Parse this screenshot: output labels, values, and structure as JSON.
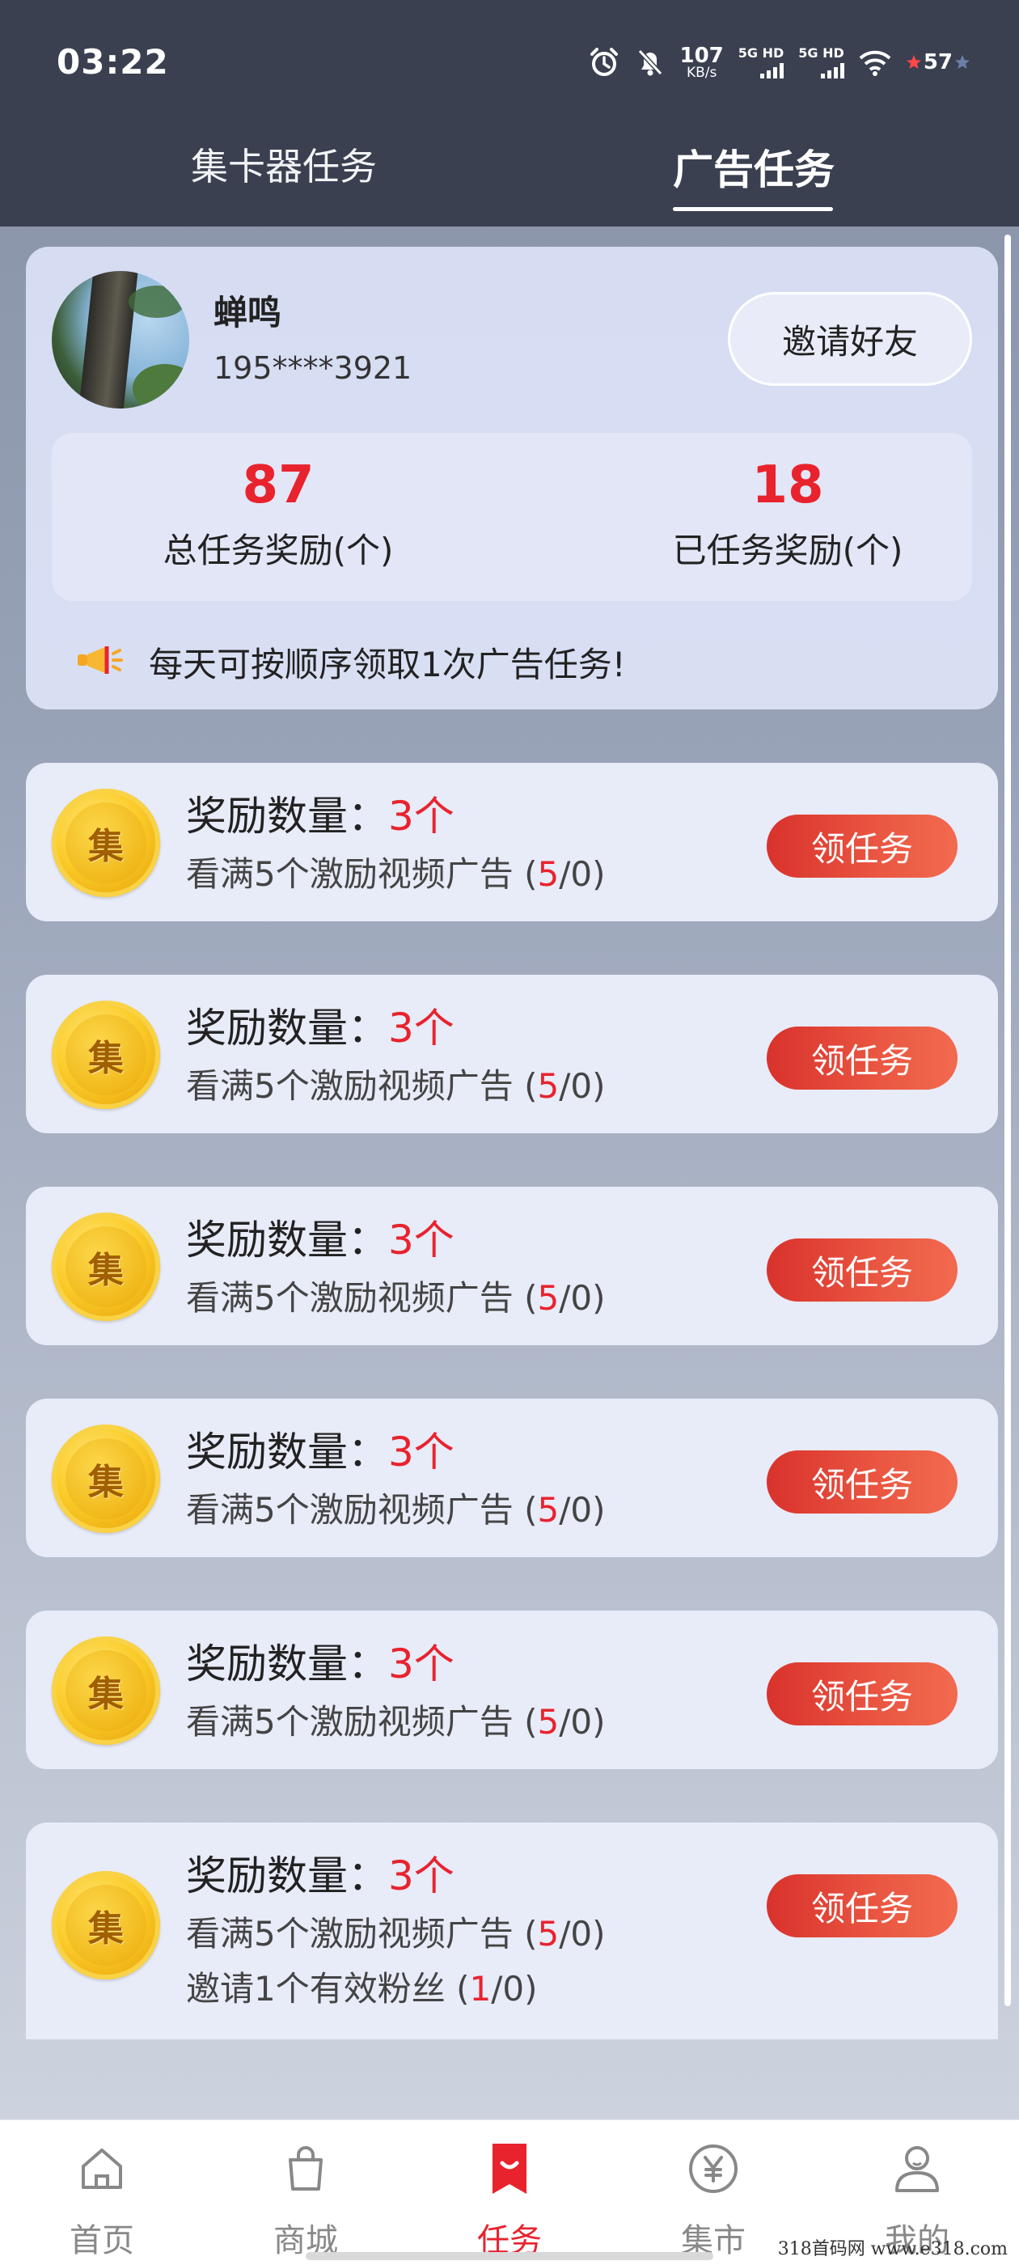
{
  "status_bar": {
    "time": "03:22",
    "net_speed_value": "107",
    "net_speed_unit": "KB/s",
    "signal_1_label": "5G HD",
    "signal_2_label": "5G HD",
    "battery": "57"
  },
  "tabs": [
    {
      "label": "集卡器任务"
    },
    {
      "label": "广告任务"
    }
  ],
  "profile": {
    "nickname": "蝉鸣",
    "phone": "195****3921",
    "invite_label": "邀请好友"
  },
  "stats": {
    "total_value": "87",
    "total_label": "总任务奖励(个)",
    "done_value": "18",
    "done_label": "已任务奖励(个)"
  },
  "notice": "每天可按顺序领取1次广告任务!",
  "tasks": [
    {
      "title_prefix": "奖励数量：",
      "reward": "3个",
      "desc_prefix": "看满5个激励视频广告 (",
      "progress_num": "5",
      "progress_suffix": "/0)",
      "button": "领任务",
      "coin_char": "集"
    },
    {
      "title_prefix": "奖励数量：",
      "reward": "3个",
      "desc_prefix": "看满5个激励视频广告 (",
      "progress_num": "5",
      "progress_suffix": "/0)",
      "button": "领任务",
      "coin_char": "集"
    },
    {
      "title_prefix": "奖励数量：",
      "reward": "3个",
      "desc_prefix": "看满5个激励视频广告 (",
      "progress_num": "5",
      "progress_suffix": "/0)",
      "button": "领任务",
      "coin_char": "集"
    },
    {
      "title_prefix": "奖励数量：",
      "reward": "3个",
      "desc_prefix": "看满5个激励视频广告 (",
      "progress_num": "5",
      "progress_suffix": "/0)",
      "button": "领任务",
      "coin_char": "集"
    },
    {
      "title_prefix": "奖励数量：",
      "reward": "3个",
      "desc_prefix": "看满5个激励视频广告 (",
      "progress_num": "5",
      "progress_suffix": "/0)",
      "button": "领任务",
      "coin_char": "集"
    },
    {
      "title_prefix": "奖励数量：",
      "reward": "3个",
      "desc_prefix": "看满5个激励视频广告 (",
      "progress_num": "5",
      "progress_suffix": "/0)",
      "button": "领任务",
      "coin_char": "集",
      "desc2_prefix": "邀请1个有效粉丝 (",
      "desc2_num": "1",
      "desc2_suffix": "/0)"
    }
  ],
  "bottom_nav": [
    {
      "label": "首页",
      "icon": "home-icon"
    },
    {
      "label": "商城",
      "icon": "shopping-bag-icon"
    },
    {
      "label": "任务",
      "icon": "task-bookmark-icon",
      "active": true
    },
    {
      "label": "集市",
      "icon": "yen-coin-icon"
    },
    {
      "label": "我的",
      "icon": "user-icon"
    }
  ],
  "watermark": "318首码网  www.e318.com",
  "colors": {
    "accent_red": "#e8232e",
    "header_bg": "#3a4050",
    "button_gradient_start": "#d9322c",
    "button_gradient_end": "#f26a4f"
  }
}
